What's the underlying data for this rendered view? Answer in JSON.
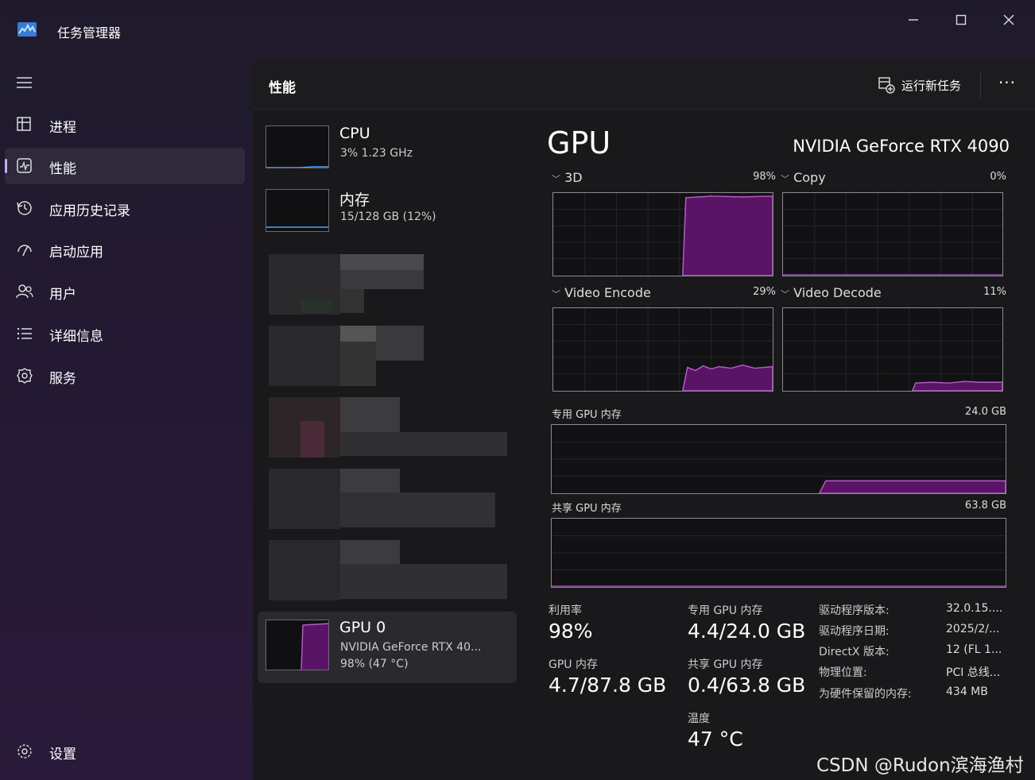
{
  "window": {
    "title": "任务管理器",
    "controls": {
      "minimize": "—",
      "maximize": "☐",
      "close": "✕"
    }
  },
  "sidebar": {
    "items": [
      {
        "label": "进程",
        "icon": "processes-icon"
      },
      {
        "label": "性能",
        "icon": "performance-icon",
        "active": true
      },
      {
        "label": "应用历史记录",
        "icon": "history-icon"
      },
      {
        "label": "启动应用",
        "icon": "startup-icon"
      },
      {
        "label": "用户",
        "icon": "users-icon"
      },
      {
        "label": "详细信息",
        "icon": "details-icon"
      },
      {
        "label": "服务",
        "icon": "services-icon"
      }
    ],
    "settings_label": "设置"
  },
  "header": {
    "title": "性能",
    "new_task_label": "运行新任务",
    "more": "···"
  },
  "devices": [
    {
      "name": "CPU",
      "sub": "3% 1.23 GHz",
      "usage": 0.03
    },
    {
      "name": "内存",
      "sub": "15/128 GB (12%)",
      "usage": 0.12
    },
    {
      "name": "GPU 0",
      "sub": "NVIDIA GeForce RTX 40...",
      "sub2": "98% (47 °C)",
      "usage": 0.98
    }
  ],
  "gpu": {
    "title": "GPU",
    "model": "NVIDIA GeForce RTX 4090",
    "engines": [
      {
        "label": "3D",
        "percent": "98%"
      },
      {
        "label": "Copy",
        "percent": "0%"
      },
      {
        "label": "Video Encode",
        "percent": "29%"
      },
      {
        "label": "Video Decode",
        "percent": "11%"
      }
    ],
    "dedicated_mem": {
      "label": "专用 GPU 内存",
      "max": "24.0 GB"
    },
    "shared_mem": {
      "label": "共享 GPU 内存",
      "max": "63.8 GB"
    },
    "stats": {
      "utilization": {
        "label": "利用率",
        "value": "98%"
      },
      "gpu_memory": {
        "label": "GPU 内存",
        "value": "4.7/87.8 GB"
      },
      "dedicated": {
        "label": "专用 GPU 内存",
        "value": "4.4/24.0 GB"
      },
      "shared": {
        "label": "共享 GPU 内存",
        "value": "0.4/63.8 GB"
      },
      "temperature": {
        "label": "温度",
        "value": "47 °C"
      }
    },
    "info": [
      {
        "label": "驱动程序版本:",
        "value": "32.0.15...."
      },
      {
        "label": "驱动程序日期:",
        "value": "2025/2/..."
      },
      {
        "label": "DirectX 版本:",
        "value": "12 (FL 1..."
      },
      {
        "label": "物理位置:",
        "value": "PCI 总线..."
      },
      {
        "label": "为硬件保留的内存:",
        "value": "434 MB"
      }
    ]
  },
  "watermark": "CSDN @Rudon滨海渔村",
  "colors": {
    "accent": "#c9a7ff",
    "gpu_line": "#b45cc8",
    "gpu_fill": "#5a1466"
  }
}
